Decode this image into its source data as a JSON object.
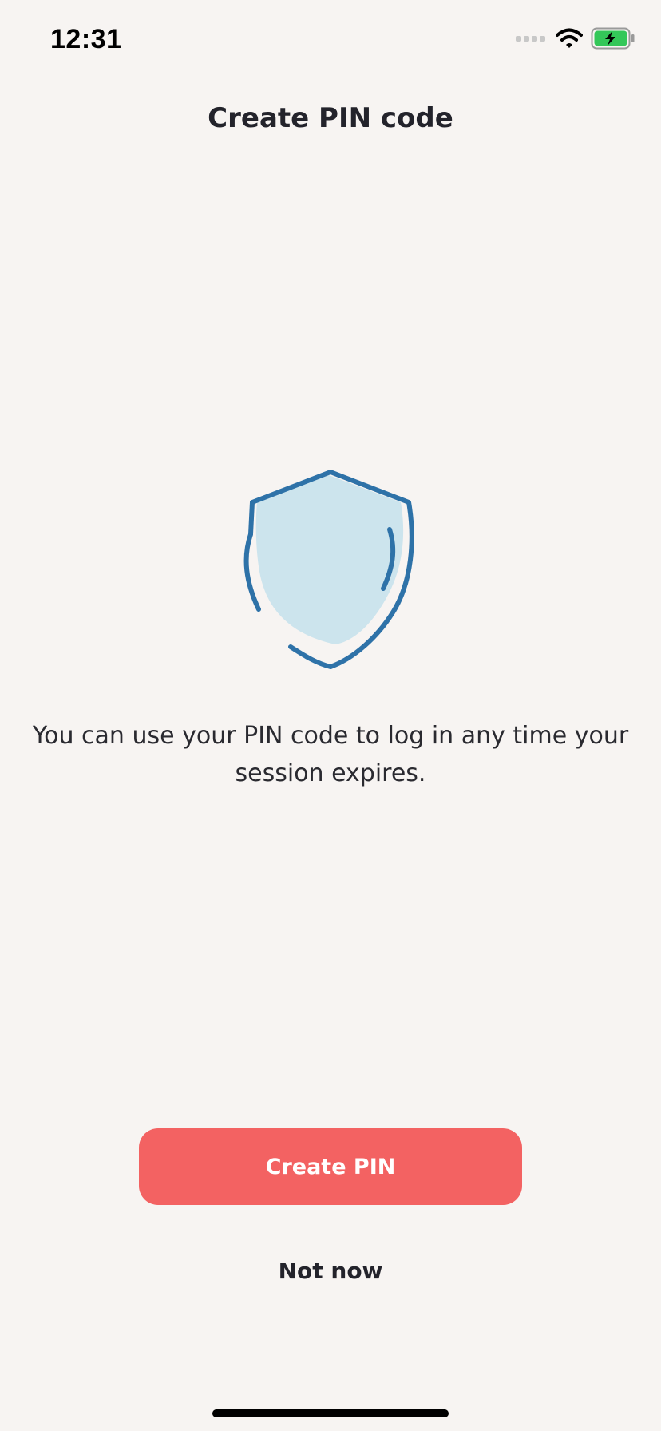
{
  "status_bar": {
    "time": "12:31",
    "icons": [
      "signal-icon",
      "wifi-icon",
      "battery-charging-icon"
    ]
  },
  "screen": {
    "title": "Create PIN code",
    "description": "You can use your PIN code to log in any time your session expires.",
    "illustration_icon": "shield-icon"
  },
  "actions": {
    "primary_label": "Create PIN",
    "secondary_label": "Not now"
  },
  "colors": {
    "background": "#f7f4f2",
    "primary_button": "#f36262",
    "shield_stroke": "#2e72a8",
    "shield_fill": "#cce4ed",
    "battery": "#34c759"
  }
}
